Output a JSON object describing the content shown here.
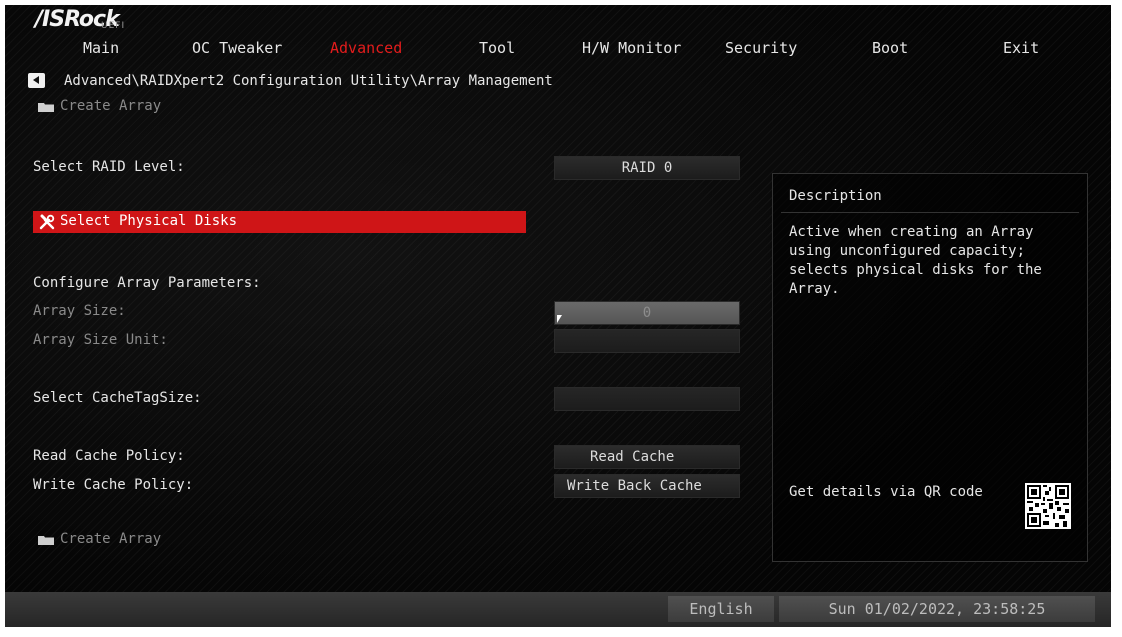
{
  "brand": {
    "logo": "/ISRock",
    "sub": "UEFI"
  },
  "tabs": [
    {
      "label": "Main"
    },
    {
      "label": "OC Tweaker"
    },
    {
      "label": "Advanced",
      "active": true
    },
    {
      "label": "Tool"
    },
    {
      "label": "H/W Monitor"
    },
    {
      "label": "Security"
    },
    {
      "label": "Boot"
    },
    {
      "label": "Exit"
    }
  ],
  "breadcrumb": "Advanced\\RAIDXpert2 Configuration Utility\\Array Management",
  "create_array_top": "Create Array",
  "create_array_bottom": "Create Array",
  "form": {
    "raid_level_label": "Select RAID Level:",
    "raid_level_value": "RAID 0",
    "select_disks_label": "Select Physical Disks",
    "configure_params_label": "Configure Array Parameters:",
    "array_size_label": "Array Size:",
    "array_size_value": "0",
    "array_size_unit_label": "Array Size Unit:",
    "array_size_unit_value": "",
    "cache_tag_label": "Select CacheTagSize:",
    "cache_tag_value": "",
    "read_cache_label": "Read Cache Policy:",
    "read_cache_value": "Read Cache",
    "write_cache_label": "Write Cache Policy:",
    "write_cache_value": "Write Back Cache"
  },
  "description": {
    "title": "Description",
    "text": "Active when creating an Array using unconfigured capacity; selects physical disks for the Array.",
    "qr_label": "Get details via QR code"
  },
  "footer": {
    "language": "English",
    "datetime": "Sun 01/02/2022, 23:58:25"
  },
  "colors": {
    "accent": "#cf1517",
    "active_tab": "#e31c1c"
  }
}
